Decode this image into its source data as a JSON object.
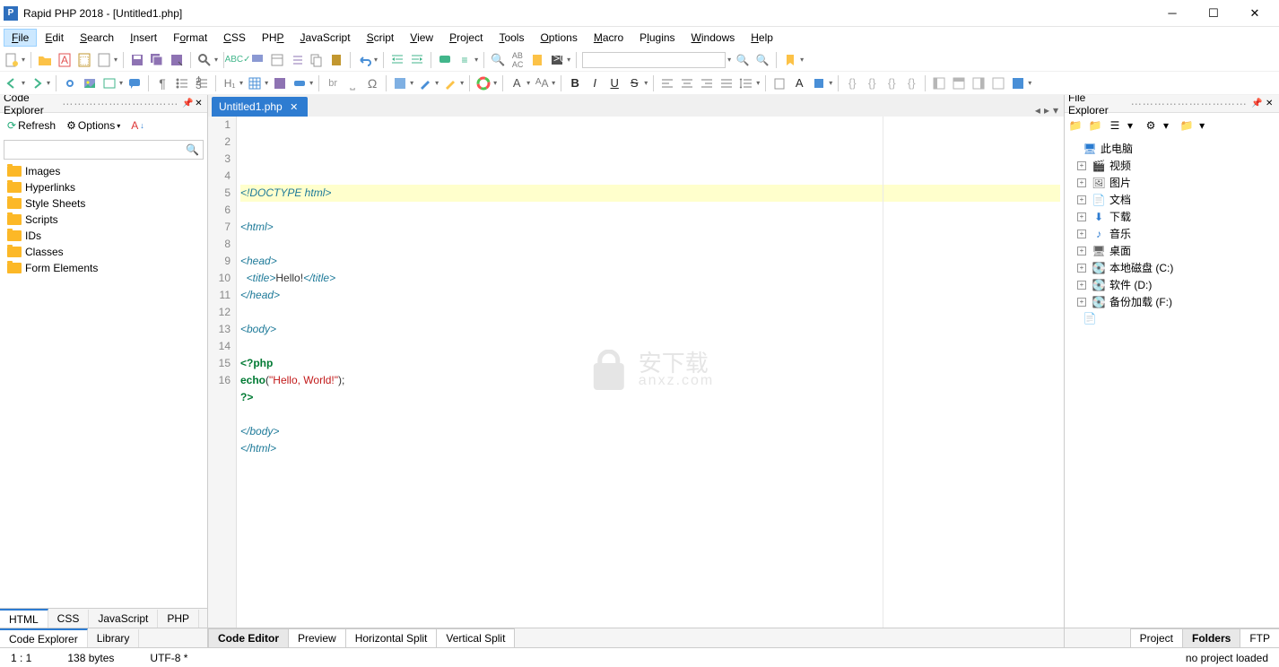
{
  "title": "Rapid PHP 2018 - [Untitled1.php]",
  "menu": [
    "File",
    "Edit",
    "Search",
    "Insert",
    "Format",
    "CSS",
    "PHP",
    "JavaScript",
    "Script",
    "View",
    "Project",
    "Tools",
    "Options",
    "Macro",
    "Plugins",
    "Windows",
    "Help"
  ],
  "menu_underline": [
    0,
    0,
    0,
    0,
    1,
    0,
    2,
    0,
    0,
    0,
    0,
    0,
    0,
    0,
    1,
    0,
    0
  ],
  "codeExplorer": {
    "title": "Code Explorer",
    "refresh": "Refresh",
    "options": "Options",
    "items": [
      "Images",
      "Hyperlinks",
      "Style Sheets",
      "Scripts",
      "IDs",
      "Classes",
      "Form Elements"
    ]
  },
  "tab": {
    "name": "Untitled1.php"
  },
  "code": [
    {
      "n": 1,
      "hl": true,
      "h": "<span class='tag'>&lt;!DOCTYPE html&gt;</span>"
    },
    {
      "n": 2,
      "h": ""
    },
    {
      "n": 3,
      "h": "<span class='tag'>&lt;html&gt;</span>"
    },
    {
      "n": 4,
      "h": ""
    },
    {
      "n": 5,
      "h": "<span class='tag'>&lt;head&gt;</span>"
    },
    {
      "n": 6,
      "h": "  <span class='tag'>&lt;title&gt;</span><span class='txt'>Hello!</span><span class='tag'>&lt;/title&gt;</span>"
    },
    {
      "n": 7,
      "h": "<span class='tag'>&lt;/head&gt;</span>"
    },
    {
      "n": 8,
      "h": ""
    },
    {
      "n": 9,
      "h": "<span class='tag'>&lt;body&gt;</span>"
    },
    {
      "n": 10,
      "h": ""
    },
    {
      "n": 11,
      "h": "<span class='kw'>&lt;?php</span>"
    },
    {
      "n": 12,
      "h": "<span class='kw'>echo</span><span class='fn'>(</span><span class='str'>\"Hello, World!\"</span><span class='fn'>);</span>"
    },
    {
      "n": 13,
      "h": "<span class='kw'>?&gt;</span>"
    },
    {
      "n": 14,
      "h": ""
    },
    {
      "n": 15,
      "h": "<span class='tag'>&lt;/body&gt;</span>"
    },
    {
      "n": 16,
      "h": "<span class='tag'>&lt;/html&gt;</span>"
    }
  ],
  "fileExplorer": {
    "title": "File Explorer",
    "root": "此电脑",
    "items": [
      {
        "icon": "🎬",
        "label": "视频"
      },
      {
        "icon": "🖼",
        "label": "图片"
      },
      {
        "icon": "📄",
        "label": "文档"
      },
      {
        "icon": "⬇",
        "label": "下载",
        "color": "#2e7cd1"
      },
      {
        "icon": "♪",
        "label": "音乐",
        "color": "#2e7cd1"
      },
      {
        "icon": "🖥",
        "label": "桌面"
      },
      {
        "icon": "💽",
        "label": "本地磁盘 (C:)"
      },
      {
        "icon": "💽",
        "label": "软件 (D:)"
      },
      {
        "icon": "💽",
        "label": "备份加载 (F:)"
      }
    ]
  },
  "bottomLeft": [
    "HTML",
    "CSS",
    "JavaScript",
    "PHP"
  ],
  "bottomLeft2": [
    "Code Explorer",
    "Library"
  ],
  "bottomCenter": [
    "Code Editor",
    "Preview",
    "Horizontal Split",
    "Vertical Split"
  ],
  "bottomRight": [
    "Project",
    "Folders",
    "FTP"
  ],
  "status": {
    "pos": "1 : 1",
    "bytes": "138 bytes",
    "enc": "UTF-8 *",
    "proj": "no project loaded"
  }
}
